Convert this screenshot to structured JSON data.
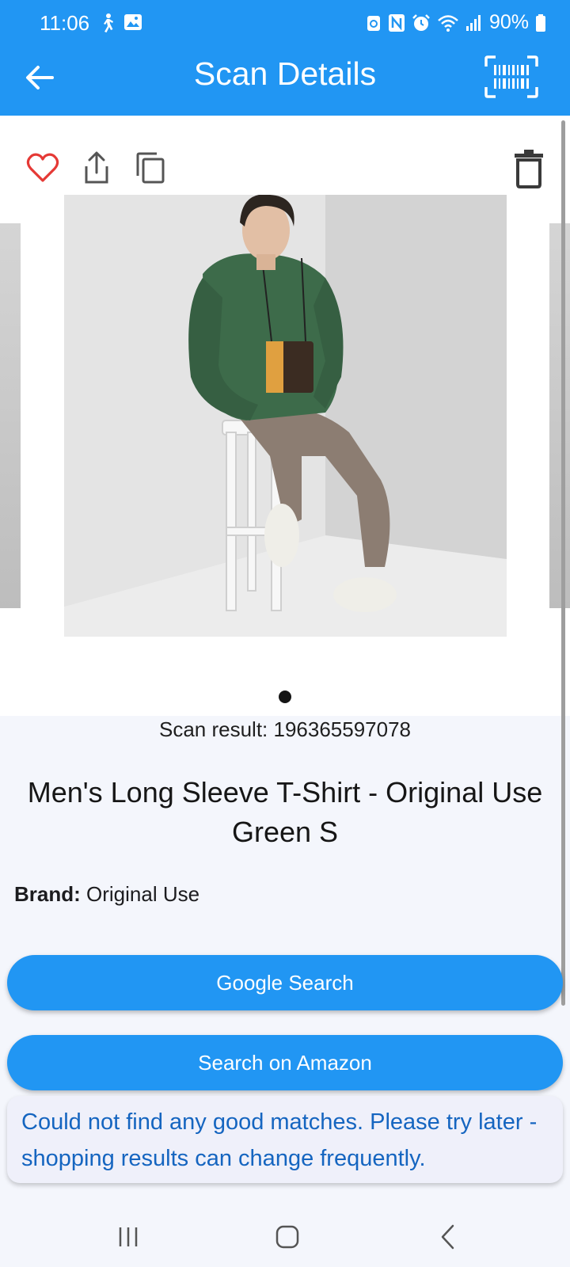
{
  "status_bar": {
    "time": "11:06",
    "battery": "90%"
  },
  "app_bar": {
    "title": "Scan Details",
    "back_icon": "arrow-left-icon",
    "scan_icon": "barcode-scan-icon"
  },
  "actions": {
    "favorite_icon": "heart-icon",
    "share_icon": "share-icon",
    "copy_icon": "copy-icon",
    "delete_icon": "trash-icon"
  },
  "carousel": {
    "image_description_icon": "product-photo",
    "active_dot": 1,
    "total_dots": 1
  },
  "product": {
    "scan_result": "Scan result: 196365597078",
    "title": "Men's Long Sleeve T-Shirt - Original Use Green S",
    "brand_label": "Brand:",
    "brand_value": "Original Use"
  },
  "buttons": {
    "google": "Google Search",
    "amazon": "Search on Amazon"
  },
  "notice": {
    "text": "Could not find any good matches. Please try later - shopping results can change frequently."
  },
  "colors": {
    "primary": "#2196f3",
    "favorite": "#e53935",
    "notice_text": "#1565c0"
  }
}
